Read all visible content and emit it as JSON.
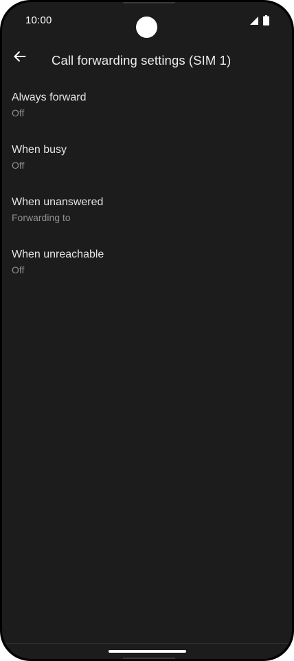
{
  "status_bar": {
    "time": "10:00",
    "icons": [
      "signal-icon",
      "battery-icon"
    ]
  },
  "app_bar": {
    "back_icon": "arrow-left-icon",
    "title": "Call forwarding settings (SIM 1)"
  },
  "settings": {
    "items": [
      {
        "title": "Always forward",
        "summary": "Off"
      },
      {
        "title": "When busy",
        "summary": "Off"
      },
      {
        "title": "When unanswered",
        "summary": "Forwarding to"
      },
      {
        "title": "When unreachable",
        "summary": "Off"
      }
    ]
  },
  "colors": {
    "background": "#1c1c1c",
    "primary_text": "#e4e4e4",
    "secondary_text": "#8f8f8f"
  }
}
